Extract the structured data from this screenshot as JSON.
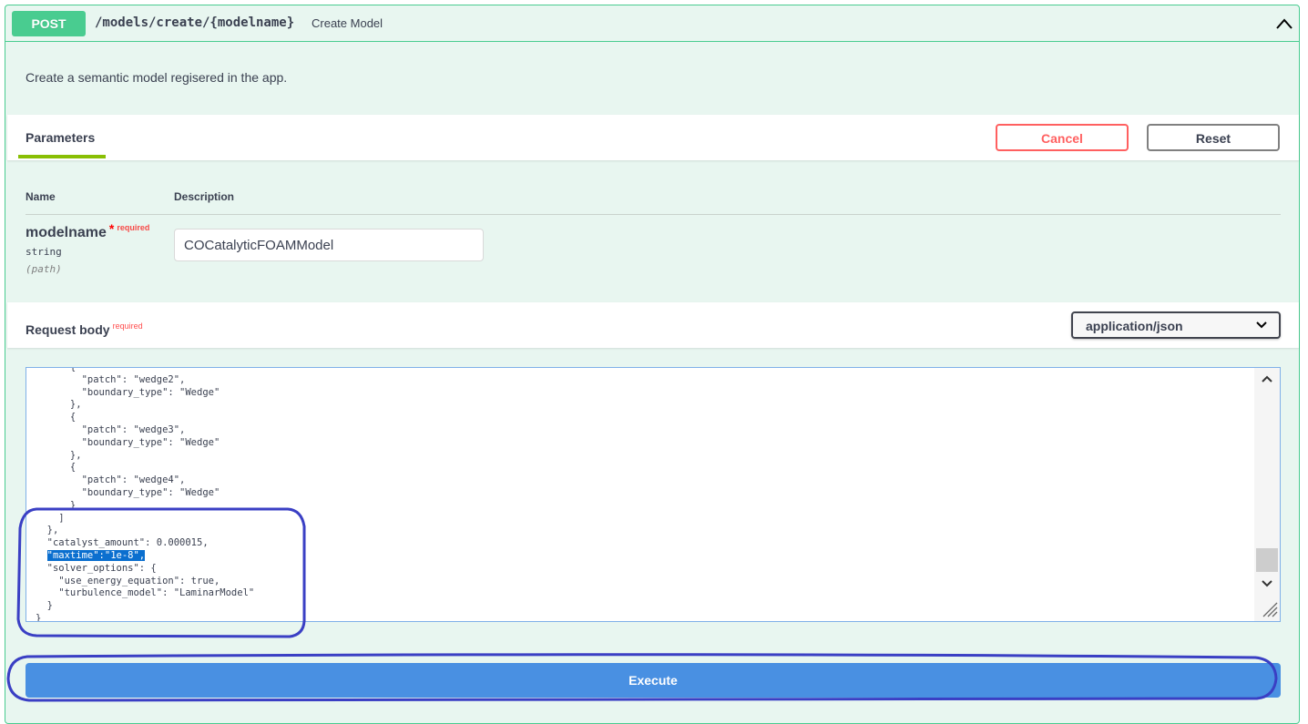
{
  "endpoint": {
    "method": "POST",
    "path": "/models/create/{modelname}",
    "summary": "Create Model",
    "description": "Create a semantic model regisered in the app."
  },
  "parameters": {
    "tab_label": "Parameters",
    "cancel_label": "Cancel",
    "reset_label": "Reset",
    "col_name": "Name",
    "col_description": "Description",
    "param": {
      "name": "modelname",
      "required_star": "*",
      "required_label": "required",
      "type": "string",
      "location": "(path)",
      "value": "COCatalyticFOAMModel"
    }
  },
  "request_body": {
    "title": "Request body",
    "required_label": "required",
    "content_type": "application/json",
    "code_lines": [
      "      {",
      "        \"patch\": \"wedge2\",",
      "        \"boundary_type\": \"Wedge\"",
      "      },",
      "      {",
      "        \"patch\": \"wedge3\",",
      "        \"boundary_type\": \"Wedge\"",
      "      },",
      "      {",
      "        \"patch\": \"wedge4\",",
      "        \"boundary_type\": \"Wedge\"",
      "      }",
      "    ]",
      "  },",
      "  \"catalyst_amount\": 0.000015,",
      "  \"maxtime\":\"1e-8\",",
      "  \"solver_options\": {",
      "    \"use_energy_equation\": true,",
      "    \"turbulence_model\": \"LaminarModel\"",
      "  }",
      "}"
    ],
    "highlighted_line": 15
  },
  "execute_label": "Execute",
  "colors": {
    "post_green": "#49cc90",
    "cancel_red": "#ff6060",
    "execute_blue": "#4990e2",
    "annotation_blue": "#3a3fc4",
    "selection_blue": "#0b6fcf"
  }
}
